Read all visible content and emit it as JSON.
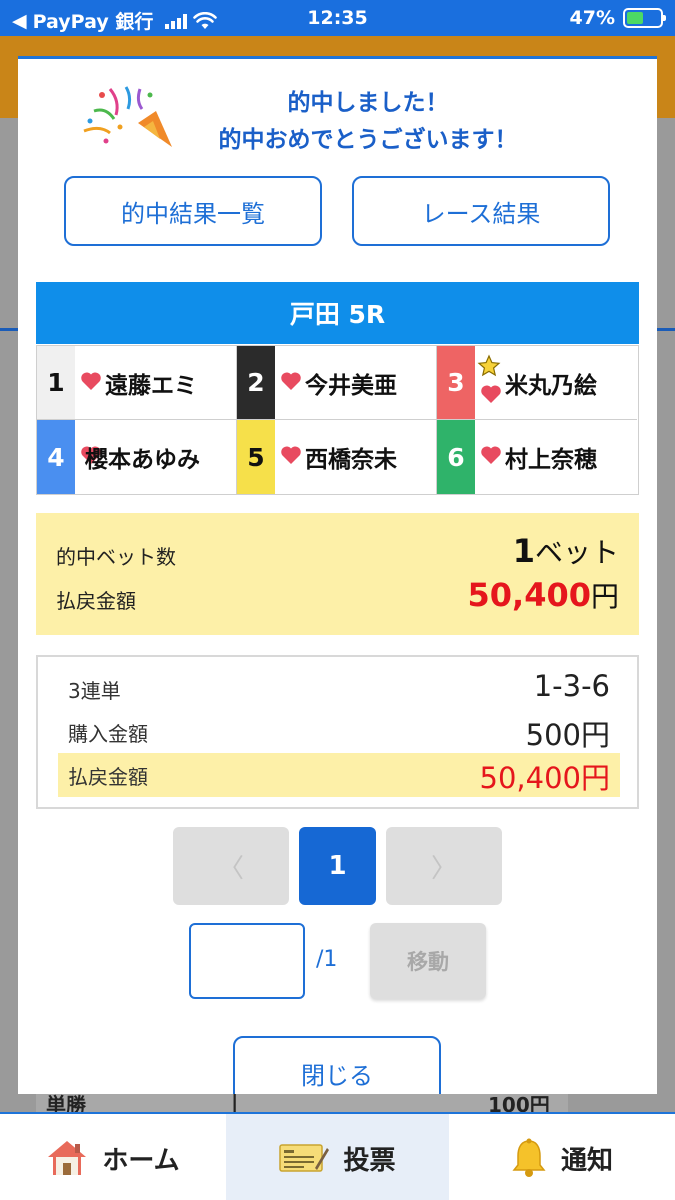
{
  "status_bar": {
    "back_app": "PayPay 銀行",
    "time": "12:35",
    "battery": "47%"
  },
  "background": {
    "row_label": "単勝",
    "row_value": "100円"
  },
  "modal": {
    "congrats_line1": "的中しました！",
    "congrats_line2": "的中おめでとうございます！",
    "hit_list_button": "的中結果一覧",
    "race_result_button": "レース結果",
    "race_title": "戸田 5R",
    "racers": [
      {
        "num": "1",
        "name": "遠藤エミ",
        "bg": "#f0f0f0",
        "fg": "#111111"
      },
      {
        "num": "2",
        "name": "今井美亜",
        "bg": "#2b2b2b",
        "fg": "#ffffff"
      },
      {
        "num": "3",
        "name": "米丸乃絵",
        "bg": "#ee6464",
        "fg": "#ffffff"
      },
      {
        "num": "4",
        "name": "櫻本あゆみ",
        "bg": "#4a8ff0",
        "fg": "#ffffff"
      },
      {
        "num": "5",
        "name": "西橋奈未",
        "bg": "#f6e04a",
        "fg": "#111111"
      },
      {
        "num": "6",
        "name": "村上奈穂",
        "bg": "#2fb36a",
        "fg": "#ffffff"
      }
    ],
    "summary": {
      "bets_label": "的中ベット数",
      "bets_value": "1",
      "bets_unit": "ベット",
      "payout_label": "払戻金額",
      "payout_value": "50,400",
      "payout_unit": "円"
    },
    "detail": {
      "bet_type": "3連単",
      "combination": "1-3-6",
      "purchase_label": "購入金額",
      "purchase_value": "500円",
      "payout_label": "払戻金額",
      "payout_value": "50,400円"
    },
    "pagination": {
      "prev": "〈",
      "current": "1",
      "next": "〉",
      "total": "/1",
      "move_button": "移動"
    },
    "close_button": "閉じる"
  },
  "tabbar": {
    "home": "ホーム",
    "vote": "投票",
    "notify": "通知"
  },
  "colors": {
    "accent": "#1e6fd6",
    "header_blue": "#0f8eea",
    "payout_red": "#e5161c",
    "highlight_yellow": "#fdf0a8"
  }
}
